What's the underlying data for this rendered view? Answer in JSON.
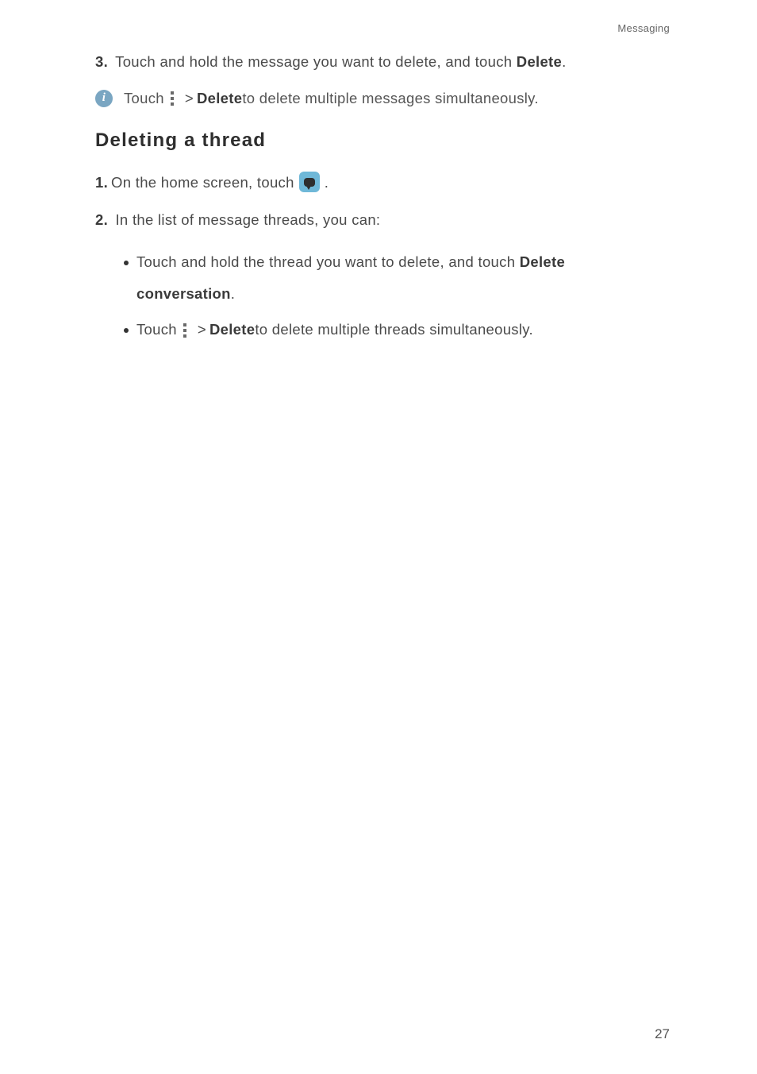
{
  "header": "Messaging",
  "step3": {
    "num": "3.",
    "text_before": "Touch and hold the message you want to delete, and touch ",
    "bold": "Delete",
    "text_after": "."
  },
  "info": {
    "touch": "Touch",
    "gt": ">",
    "delete": "Delete",
    "rest": " to delete multiple messages simultaneously."
  },
  "heading": "Deleting  a  thread",
  "step1": {
    "num": "1.",
    "text": "On the home screen, touch ",
    "period": "."
  },
  "step2": {
    "num": "2.",
    "text": "In the list of message threads, you can:"
  },
  "bullet1": {
    "text_before": "Touch and hold the thread you want to delete, and touch ",
    "bold1": "Delete",
    "bold2": "conversation",
    "period": "."
  },
  "bullet2": {
    "touch": "Touch",
    "gt": ">",
    "delete": "Delete",
    "rest": " to delete multiple threads simultaneously."
  },
  "pagenum": "27"
}
